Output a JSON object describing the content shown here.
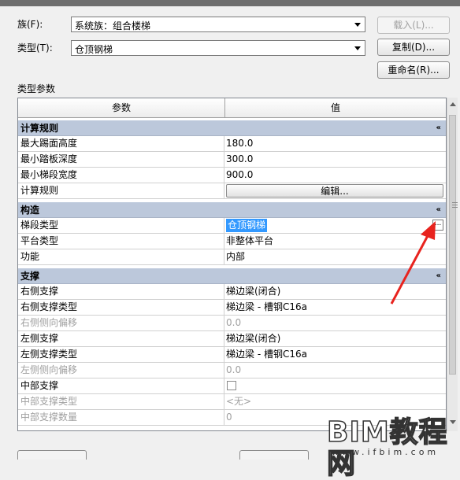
{
  "family": {
    "label": "族(F):",
    "value": "系统族：组合楼梯"
  },
  "type": {
    "label": "类型(T):",
    "value": "仓顶钢梯"
  },
  "buttons": {
    "load": "载入(L)...",
    "duplicate": "复制(D)...",
    "rename": "重命名(R)..."
  },
  "params_title": "类型参数",
  "grid": {
    "col_param": "参数",
    "col_value": "值",
    "groups": {
      "calc": "计算规则",
      "construction": "构造",
      "support": "支撑"
    },
    "calc_rows": [
      {
        "k": "最大踢面高度",
        "v": "180.0"
      },
      {
        "k": "最小踏板深度",
        "v": "300.0"
      },
      {
        "k": "最小梯段宽度",
        "v": "900.0"
      },
      {
        "k": "计算规则",
        "v": "编辑..."
      }
    ],
    "construction_rows": [
      {
        "k": "梯段类型",
        "v": "仓顶钢梯"
      },
      {
        "k": "平台类型",
        "v": "非整体平台"
      },
      {
        "k": "功能",
        "v": "内部"
      }
    ],
    "support_rows": [
      {
        "k": "右侧支撑",
        "v": "梯边梁(闭合)"
      },
      {
        "k": "右侧支撑类型",
        "v": "梯边梁 - 槽钢C16a"
      },
      {
        "k": "右侧侧向偏移",
        "v": "0.0"
      },
      {
        "k": "左侧支撑",
        "v": "梯边梁(闭合)"
      },
      {
        "k": "左侧支撑类型",
        "v": "梯边梁 - 槽钢C16a"
      },
      {
        "k": "左侧侧向偏移",
        "v": "0.0"
      },
      {
        "k": "中部支撑",
        "v": ""
      },
      {
        "k": "中部支撑类型",
        "v": "<无>"
      },
      {
        "k": "中部支撑数量",
        "v": "0"
      }
    ],
    "collapse_glyph": "«",
    "dots": "..."
  },
  "watermark": {
    "big": "BIM教程网",
    "small": "www.ifbim.com"
  },
  "colors": {
    "group_header": "#bcc8db",
    "selection": "#3399ff",
    "arrow": "#e8231e"
  }
}
